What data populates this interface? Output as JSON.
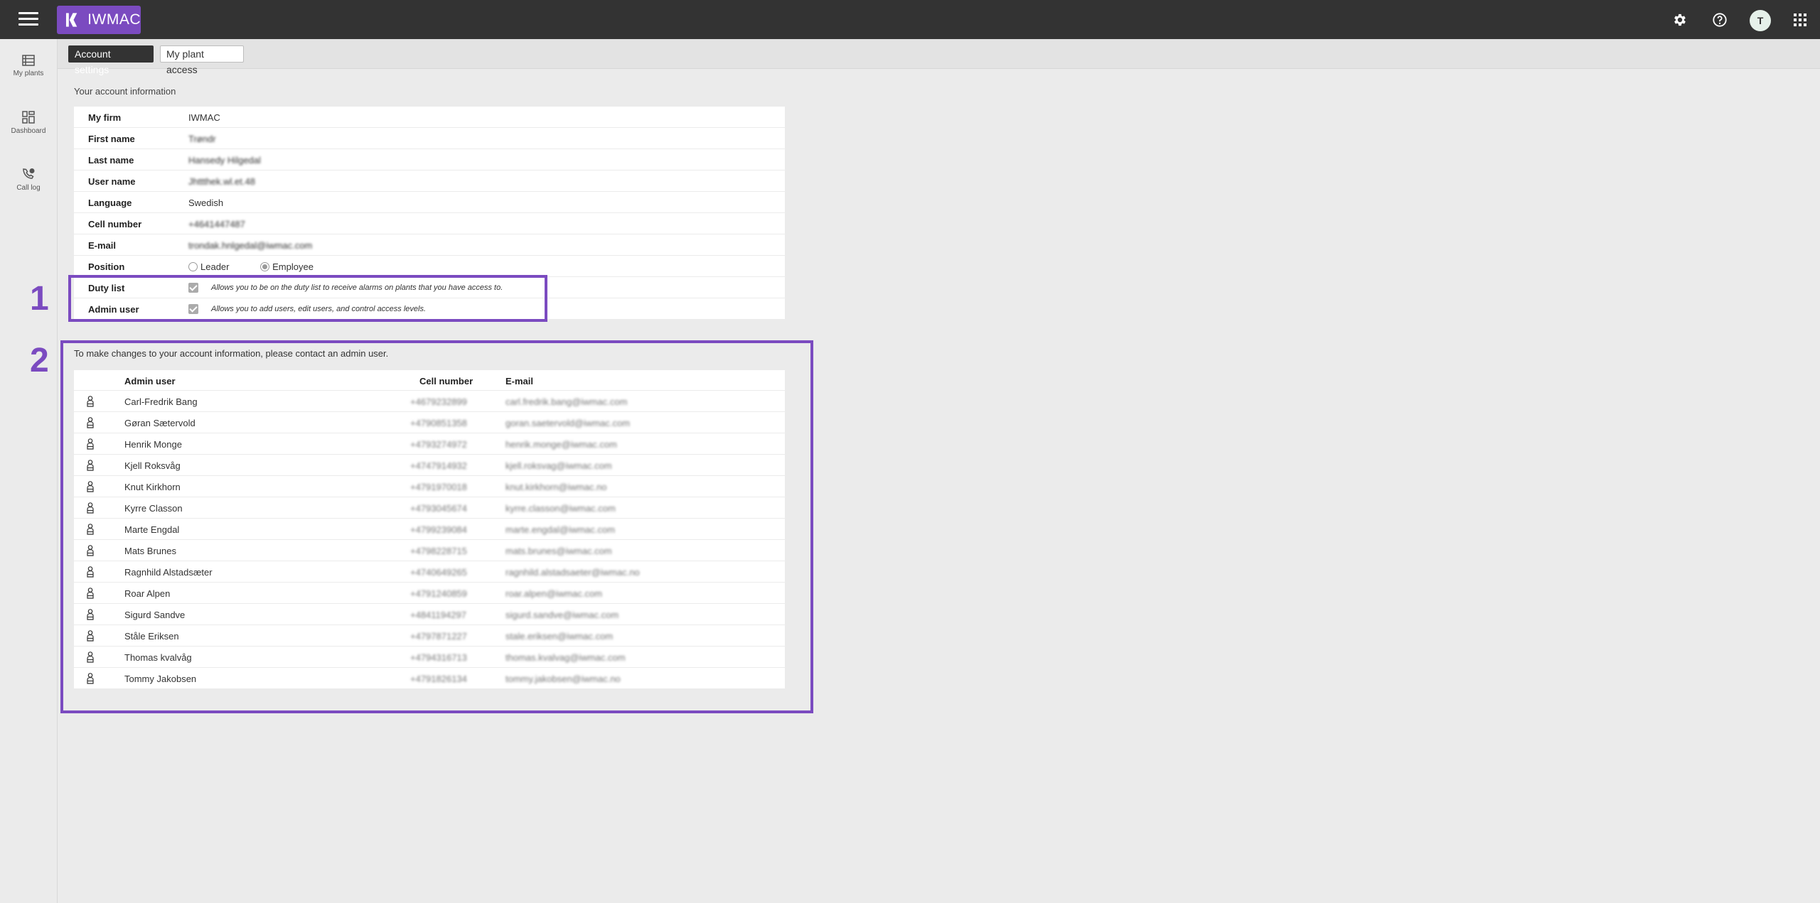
{
  "app": {
    "brand": "IWMAC",
    "avatar_initial": "T",
    "accent_color": "#7b4bc0"
  },
  "sidenav": [
    {
      "label": "My plants",
      "icon": "list-icon"
    },
    {
      "label": "Dashboard",
      "icon": "dashboard-icon"
    },
    {
      "label": "Call log",
      "icon": "phone-icon"
    }
  ],
  "tabs": [
    {
      "label": "Account settings",
      "active": true
    },
    {
      "label": "My plant access",
      "active": false
    }
  ],
  "account": {
    "section_title": "Your account information",
    "rows": {
      "firm": {
        "label": "My firm",
        "value": "IWMAC"
      },
      "first_name": {
        "label": "First name",
        "value": "Trøndr"
      },
      "last_name": {
        "label": "Last name",
        "value": "Hansedy Hilgedal"
      },
      "user_name": {
        "label": "User name",
        "value": "Jhttthek.wl.et.48"
      },
      "language": {
        "label": "Language",
        "value": "Swedish"
      },
      "cell": {
        "label": "Cell number",
        "value": "+4641447487"
      },
      "email": {
        "label": "E-mail",
        "value": "trondak.hnlgedal@iwmac.com"
      },
      "position": {
        "label": "Position",
        "option_leader": "Leader",
        "option_employee": "Employee",
        "selected": "Employee"
      },
      "duty": {
        "label": "Duty list",
        "checked": true,
        "description": "Allows you to be on the duty list to receive alarms on plants that you have access to."
      },
      "admin": {
        "label": "Admin user",
        "checked": true,
        "description": "Allows you to add users, edit users, and control access levels."
      }
    }
  },
  "callouts": [
    "1",
    "2"
  ],
  "admins": {
    "note": "To make changes to your account information, please contact an admin user.",
    "headers": {
      "name": "Admin user",
      "cell": "Cell number",
      "email": "E-mail"
    },
    "rows": [
      {
        "name": "Carl-Fredrik Bang",
        "cell": "+4679232899",
        "email": "carl.fredrik.bang@iwmac.com"
      },
      {
        "name": "Gøran Sætervold",
        "cell": "+4790851358",
        "email": "goran.saetervold@iwmac.com"
      },
      {
        "name": "Henrik Monge",
        "cell": "+4793274972",
        "email": "henrik.monge@iwmac.com"
      },
      {
        "name": "Kjell Roksvåg",
        "cell": "+4747914932",
        "email": "kjell.roksvag@iwmac.com"
      },
      {
        "name": "Knut Kirkhorn",
        "cell": "+4791970018",
        "email": "knut.kirkhorn@iwmac.no"
      },
      {
        "name": "Kyrre Classon",
        "cell": "+4793045674",
        "email": "kyrre.classon@iwmac.com"
      },
      {
        "name": "Marte Engdal",
        "cell": "+4799239084",
        "email": "marte.engdal@iwmac.com"
      },
      {
        "name": "Mats Brunes",
        "cell": "+4798228715",
        "email": "mats.brunes@iwmac.com"
      },
      {
        "name": "Ragnhild Alstadsæter",
        "cell": "+4740649265",
        "email": "ragnhild.alstadsaeter@iwmac.no"
      },
      {
        "name": "Roar Alpen",
        "cell": "+4791240859",
        "email": "roar.alpen@iwmac.com"
      },
      {
        "name": "Sigurd Sandve",
        "cell": "+4841194297",
        "email": "sigurd.sandve@iwmac.com"
      },
      {
        "name": "Ståle Eriksen",
        "cell": "+4797871227",
        "email": "stale.eriksen@iwmac.com"
      },
      {
        "name": "Thomas kvalvåg",
        "cell": "+4794316713",
        "email": "thomas.kvalvag@iwmac.com"
      },
      {
        "name": "Tommy Jakobsen",
        "cell": "+4791826134",
        "email": "tommy.jakobsen@iwmac.no"
      }
    ]
  }
}
